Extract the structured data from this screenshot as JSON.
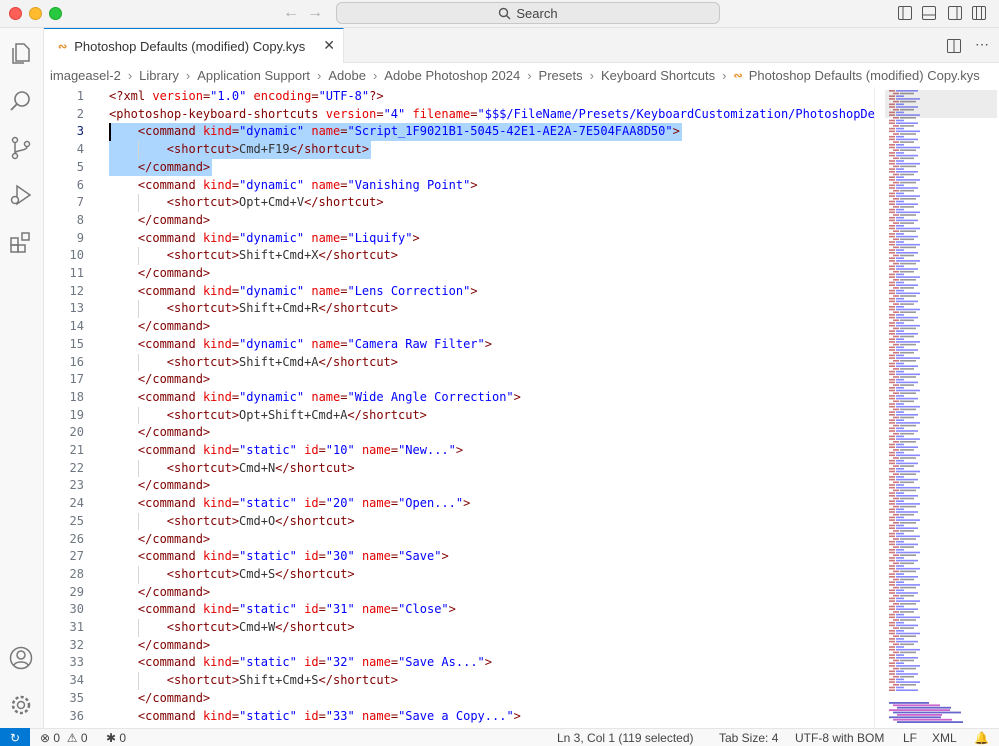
{
  "window": {
    "search_label": "Search",
    "accent": "#0078d4"
  },
  "activity_bar": {
    "items": [
      "explorer-icon",
      "search-icon",
      "source-control-icon",
      "run-debug-icon",
      "extensions-icon"
    ],
    "bottom": [
      "accounts-icon",
      "manage-gear-icon"
    ]
  },
  "tab": {
    "label": "Photoshop Defaults (modified) Copy.kys",
    "icon": "rss-icon"
  },
  "breadcrumb": [
    "imageasel-2",
    "Library",
    "Application Support",
    "Adobe",
    "Adobe Photoshop 2024",
    "Presets",
    "Keyboard Shortcuts",
    "Photoshop Defaults (modified) Copy.kys"
  ],
  "editor": {
    "lines": [
      {
        "n": "1",
        "t": [
          [
            "tag",
            "<?xml "
          ],
          [
            "attr",
            "version"
          ],
          [
            "tag",
            "="
          ],
          [
            "val",
            "\"1.0\""
          ],
          [
            "tag",
            " "
          ],
          [
            "attr",
            "encoding"
          ],
          [
            "tag",
            "="
          ],
          [
            "val",
            "\"UTF-8\""
          ],
          [
            "tag",
            "?>"
          ]
        ]
      },
      {
        "n": "2",
        "t": [
          [
            "tag",
            "<photoshop-keyboard-shortcuts "
          ],
          [
            "attr",
            "version"
          ],
          [
            "tag",
            "="
          ],
          [
            "val",
            "\"4\""
          ],
          [
            "tag",
            " "
          ],
          [
            "attr",
            "filename"
          ],
          [
            "tag",
            "="
          ],
          [
            "val",
            "\"$$$/FileName/Presets/KeyboardCustomization/PhotoshopDefa"
          ]
        ]
      },
      {
        "n": "3",
        "t": [
          [
            "txt",
            "    "
          ],
          [
            "tag",
            "<command "
          ],
          [
            "attr",
            "kind"
          ],
          [
            "tag",
            "="
          ],
          [
            "val",
            "\"dynamic\""
          ],
          [
            "tag",
            " "
          ],
          [
            "attr",
            "name"
          ],
          [
            "tag",
            "="
          ],
          [
            "val",
            "\"Script_1F9021B1-5045-42E1-AE2A-7E504FAA8D50\""
          ],
          [
            "tag",
            ">"
          ]
        ]
      },
      {
        "n": "4",
        "t": [
          [
            "txt",
            "        "
          ],
          [
            "tag",
            "<shortcut>"
          ],
          [
            "txt",
            "Cmd+F19"
          ],
          [
            "tag",
            "</shortcut>"
          ]
        ]
      },
      {
        "n": "5",
        "t": [
          [
            "txt",
            "    "
          ],
          [
            "tag",
            "</command>"
          ]
        ]
      },
      {
        "n": "6",
        "t": [
          [
            "txt",
            "    "
          ],
          [
            "tag",
            "<command "
          ],
          [
            "attr",
            "kind"
          ],
          [
            "tag",
            "="
          ],
          [
            "val",
            "\"dynamic\""
          ],
          [
            "tag",
            " "
          ],
          [
            "attr",
            "name"
          ],
          [
            "tag",
            "="
          ],
          [
            "val",
            "\"Vanishing Point\""
          ],
          [
            "tag",
            ">"
          ]
        ]
      },
      {
        "n": "7",
        "t": [
          [
            "txt",
            "        "
          ],
          [
            "tag",
            "<shortcut>"
          ],
          [
            "txt",
            "Opt+Cmd+V"
          ],
          [
            "tag",
            "</shortcut>"
          ]
        ]
      },
      {
        "n": "8",
        "t": [
          [
            "txt",
            "    "
          ],
          [
            "tag",
            "</command>"
          ]
        ]
      },
      {
        "n": "9",
        "t": [
          [
            "txt",
            "    "
          ],
          [
            "tag",
            "<command "
          ],
          [
            "attr",
            "kind"
          ],
          [
            "tag",
            "="
          ],
          [
            "val",
            "\"dynamic\""
          ],
          [
            "tag",
            " "
          ],
          [
            "attr",
            "name"
          ],
          [
            "tag",
            "="
          ],
          [
            "val",
            "\"Liquify\""
          ],
          [
            "tag",
            ">"
          ]
        ]
      },
      {
        "n": "10",
        "t": [
          [
            "txt",
            "        "
          ],
          [
            "tag",
            "<shortcut>"
          ],
          [
            "txt",
            "Shift+Cmd+X"
          ],
          [
            "tag",
            "</shortcut>"
          ]
        ]
      },
      {
        "n": "11",
        "t": [
          [
            "txt",
            "    "
          ],
          [
            "tag",
            "</command>"
          ]
        ]
      },
      {
        "n": "12",
        "t": [
          [
            "txt",
            "    "
          ],
          [
            "tag",
            "<command "
          ],
          [
            "attr",
            "kind"
          ],
          [
            "tag",
            "="
          ],
          [
            "val",
            "\"dynamic\""
          ],
          [
            "tag",
            " "
          ],
          [
            "attr",
            "name"
          ],
          [
            "tag",
            "="
          ],
          [
            "val",
            "\"Lens Correction\""
          ],
          [
            "tag",
            ">"
          ]
        ]
      },
      {
        "n": "13",
        "t": [
          [
            "txt",
            "        "
          ],
          [
            "tag",
            "<shortcut>"
          ],
          [
            "txt",
            "Shift+Cmd+R"
          ],
          [
            "tag",
            "</shortcut>"
          ]
        ]
      },
      {
        "n": "14",
        "t": [
          [
            "txt",
            "    "
          ],
          [
            "tag",
            "</command>"
          ]
        ]
      },
      {
        "n": "15",
        "t": [
          [
            "txt",
            "    "
          ],
          [
            "tag",
            "<command "
          ],
          [
            "attr",
            "kind"
          ],
          [
            "tag",
            "="
          ],
          [
            "val",
            "\"dynamic\""
          ],
          [
            "tag",
            " "
          ],
          [
            "attr",
            "name"
          ],
          [
            "tag",
            "="
          ],
          [
            "val",
            "\"Camera Raw Filter\""
          ],
          [
            "tag",
            ">"
          ]
        ]
      },
      {
        "n": "16",
        "t": [
          [
            "txt",
            "        "
          ],
          [
            "tag",
            "<shortcut>"
          ],
          [
            "txt",
            "Shift+Cmd+A"
          ],
          [
            "tag",
            "</shortcut>"
          ]
        ]
      },
      {
        "n": "17",
        "t": [
          [
            "txt",
            "    "
          ],
          [
            "tag",
            "</command>"
          ]
        ]
      },
      {
        "n": "18",
        "t": [
          [
            "txt",
            "    "
          ],
          [
            "tag",
            "<command "
          ],
          [
            "attr",
            "kind"
          ],
          [
            "tag",
            "="
          ],
          [
            "val",
            "\"dynamic\""
          ],
          [
            "tag",
            " "
          ],
          [
            "attr",
            "name"
          ],
          [
            "tag",
            "="
          ],
          [
            "val",
            "\"Wide Angle Correction\""
          ],
          [
            "tag",
            ">"
          ]
        ]
      },
      {
        "n": "19",
        "t": [
          [
            "txt",
            "        "
          ],
          [
            "tag",
            "<shortcut>"
          ],
          [
            "txt",
            "Opt+Shift+Cmd+A"
          ],
          [
            "tag",
            "</shortcut>"
          ]
        ]
      },
      {
        "n": "20",
        "t": [
          [
            "txt",
            "    "
          ],
          [
            "tag",
            "</command>"
          ]
        ]
      },
      {
        "n": "21",
        "t": [
          [
            "txt",
            "    "
          ],
          [
            "tag",
            "<command "
          ],
          [
            "attr",
            "kind"
          ],
          [
            "tag",
            "="
          ],
          [
            "val",
            "\"static\""
          ],
          [
            "tag",
            " "
          ],
          [
            "attr",
            "id"
          ],
          [
            "tag",
            "="
          ],
          [
            "val",
            "\"10\""
          ],
          [
            "tag",
            " "
          ],
          [
            "attr",
            "name"
          ],
          [
            "tag",
            "="
          ],
          [
            "val",
            "\"New...\""
          ],
          [
            "tag",
            ">"
          ]
        ]
      },
      {
        "n": "22",
        "t": [
          [
            "txt",
            "        "
          ],
          [
            "tag",
            "<shortcut>"
          ],
          [
            "txt",
            "Cmd+N"
          ],
          [
            "tag",
            "</shortcut>"
          ]
        ]
      },
      {
        "n": "23",
        "t": [
          [
            "txt",
            "    "
          ],
          [
            "tag",
            "</command>"
          ]
        ]
      },
      {
        "n": "24",
        "t": [
          [
            "txt",
            "    "
          ],
          [
            "tag",
            "<command "
          ],
          [
            "attr",
            "kind"
          ],
          [
            "tag",
            "="
          ],
          [
            "val",
            "\"static\""
          ],
          [
            "tag",
            " "
          ],
          [
            "attr",
            "id"
          ],
          [
            "tag",
            "="
          ],
          [
            "val",
            "\"20\""
          ],
          [
            "tag",
            " "
          ],
          [
            "attr",
            "name"
          ],
          [
            "tag",
            "="
          ],
          [
            "val",
            "\"Open...\""
          ],
          [
            "tag",
            ">"
          ]
        ]
      },
      {
        "n": "25",
        "t": [
          [
            "txt",
            "        "
          ],
          [
            "tag",
            "<shortcut>"
          ],
          [
            "txt",
            "Cmd+O"
          ],
          [
            "tag",
            "</shortcut>"
          ]
        ]
      },
      {
        "n": "26",
        "t": [
          [
            "txt",
            "    "
          ],
          [
            "tag",
            "</command>"
          ]
        ]
      },
      {
        "n": "27",
        "t": [
          [
            "txt",
            "    "
          ],
          [
            "tag",
            "<command "
          ],
          [
            "attr",
            "kind"
          ],
          [
            "tag",
            "="
          ],
          [
            "val",
            "\"static\""
          ],
          [
            "tag",
            " "
          ],
          [
            "attr",
            "id"
          ],
          [
            "tag",
            "="
          ],
          [
            "val",
            "\"30\""
          ],
          [
            "tag",
            " "
          ],
          [
            "attr",
            "name"
          ],
          [
            "tag",
            "="
          ],
          [
            "val",
            "\"Save\""
          ],
          [
            "tag",
            ">"
          ]
        ]
      },
      {
        "n": "28",
        "t": [
          [
            "txt",
            "        "
          ],
          [
            "tag",
            "<shortcut>"
          ],
          [
            "txt",
            "Cmd+S"
          ],
          [
            "tag",
            "</shortcut>"
          ]
        ]
      },
      {
        "n": "29",
        "t": [
          [
            "txt",
            "    "
          ],
          [
            "tag",
            "</command>"
          ]
        ]
      },
      {
        "n": "30",
        "t": [
          [
            "txt",
            "    "
          ],
          [
            "tag",
            "<command "
          ],
          [
            "attr",
            "kind"
          ],
          [
            "tag",
            "="
          ],
          [
            "val",
            "\"static\""
          ],
          [
            "tag",
            " "
          ],
          [
            "attr",
            "id"
          ],
          [
            "tag",
            "="
          ],
          [
            "val",
            "\"31\""
          ],
          [
            "tag",
            " "
          ],
          [
            "attr",
            "name"
          ],
          [
            "tag",
            "="
          ],
          [
            "val",
            "\"Close\""
          ],
          [
            "tag",
            ">"
          ]
        ]
      },
      {
        "n": "31",
        "t": [
          [
            "txt",
            "        "
          ],
          [
            "tag",
            "<shortcut>"
          ],
          [
            "txt",
            "Cmd+W"
          ],
          [
            "tag",
            "</shortcut>"
          ]
        ]
      },
      {
        "n": "32",
        "t": [
          [
            "txt",
            "    "
          ],
          [
            "tag",
            "</command>"
          ]
        ]
      },
      {
        "n": "33",
        "t": [
          [
            "txt",
            "    "
          ],
          [
            "tag",
            "<command "
          ],
          [
            "attr",
            "kind"
          ],
          [
            "tag",
            "="
          ],
          [
            "val",
            "\"static\""
          ],
          [
            "tag",
            " "
          ],
          [
            "attr",
            "id"
          ],
          [
            "tag",
            "="
          ],
          [
            "val",
            "\"32\""
          ],
          [
            "tag",
            " "
          ],
          [
            "attr",
            "name"
          ],
          [
            "tag",
            "="
          ],
          [
            "val",
            "\"Save As...\""
          ],
          [
            "tag",
            ">"
          ]
        ]
      },
      {
        "n": "34",
        "t": [
          [
            "txt",
            "        "
          ],
          [
            "tag",
            "<shortcut>"
          ],
          [
            "txt",
            "Shift+Cmd+S"
          ],
          [
            "tag",
            "</shortcut>"
          ]
        ]
      },
      {
        "n": "35",
        "t": [
          [
            "txt",
            "    "
          ],
          [
            "tag",
            "</command>"
          ]
        ]
      },
      {
        "n": "36",
        "t": [
          [
            "txt",
            "    "
          ],
          [
            "tag",
            "<command "
          ],
          [
            "attr",
            "kind"
          ],
          [
            "tag",
            "="
          ],
          [
            "val",
            "\"static\""
          ],
          [
            "tag",
            " "
          ],
          [
            "attr",
            "id"
          ],
          [
            "tag",
            "="
          ],
          [
            "val",
            "\"33\""
          ],
          [
            "tag",
            " "
          ],
          [
            "attr",
            "name"
          ],
          [
            "tag",
            "="
          ],
          [
            "val",
            "\"Save a Copy...\""
          ],
          [
            "tag",
            ">"
          ]
        ]
      }
    ],
    "current_line": "3",
    "selected_lines": [
      "3",
      "4",
      "5"
    ]
  },
  "statusbar": {
    "errors": "0",
    "warnings": "0",
    "ports": "0",
    "cursor": "Ln 3, Col 1 (119 selected)",
    "tab_size": "Tab Size: 4",
    "encoding": "UTF-8 with BOM",
    "eol": "LF",
    "language": "XML"
  },
  "colors": {
    "tag": "#800000",
    "attr": "#e50000",
    "value": "#0000ff",
    "selection": "#add6ff",
    "status_remote": "#0078d4"
  }
}
